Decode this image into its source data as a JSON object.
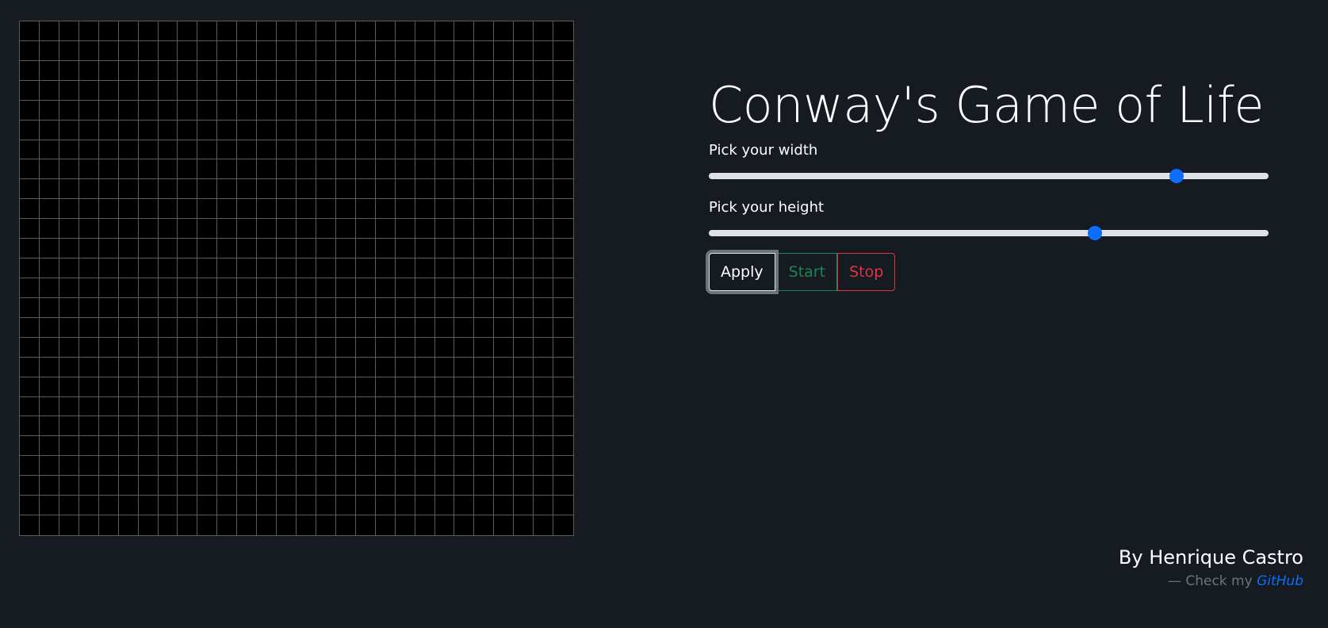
{
  "board": {
    "columns": 28,
    "rows": 26,
    "cell_color": "#000000",
    "grid_line_color": "#5c5c5c"
  },
  "controls": {
    "title": "Conway's Game of Life",
    "width_label": "Pick your width",
    "width_slider_value": 0.845,
    "height_label": "Pick your height",
    "height_slider_value": 0.695,
    "apply_label": "Apply",
    "start_label": "Start",
    "stop_label": "Stop"
  },
  "credit": {
    "author": "By Henrique Castro",
    "prefix": "— Check my",
    "link_label": "GitHub"
  },
  "colors": {
    "background": "#161a21",
    "accent": "#0d6efd",
    "start": "#198754",
    "stop": "#dc3545"
  }
}
